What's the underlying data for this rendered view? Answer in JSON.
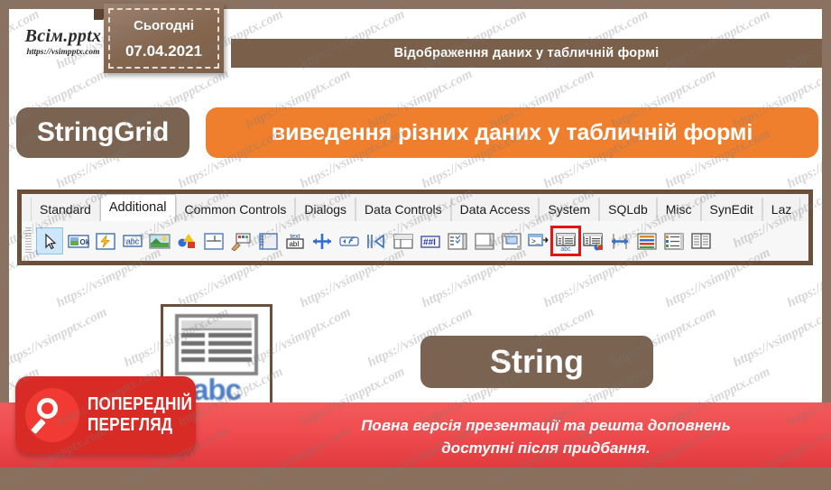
{
  "slide": {
    "logo": {
      "name": "Всім.pptx",
      "url": "https://vsimpptx.com"
    },
    "date_badge": {
      "label": "Сьогодні",
      "date": "07.04.2021"
    },
    "header_title": "Відображення даних у табличній формі",
    "tags": {
      "component": "StringGrid",
      "description": "виведення різних даних у табличній формі",
      "string": "String"
    },
    "palette": {
      "tabs": [
        {
          "label": "Standard",
          "active": false
        },
        {
          "label": "Additional",
          "active": true
        },
        {
          "label": "Common Controls",
          "active": false
        },
        {
          "label": "Dialogs",
          "active": false
        },
        {
          "label": "Data Controls",
          "active": false
        },
        {
          "label": "Data Access",
          "active": false
        },
        {
          "label": "System",
          "active": false
        },
        {
          "label": "SQLdb",
          "active": false
        },
        {
          "label": "Misc",
          "active": false
        },
        {
          "label": "SynEdit",
          "active": false
        },
        {
          "label": "Laz",
          "active": false
        }
      ],
      "icons": [
        {
          "name": "pointer-icon",
          "selected": true,
          "highlighted": false
        },
        {
          "name": "bitbtn-icon",
          "selected": false,
          "highlighted": false
        },
        {
          "name": "speedbutton-icon",
          "selected": false,
          "highlighted": false
        },
        {
          "name": "staticttext-icon",
          "selected": false,
          "highlighted": false
        },
        {
          "name": "image-icon",
          "selected": false,
          "highlighted": false
        },
        {
          "name": "shape-icon",
          "selected": false,
          "highlighted": false
        },
        {
          "name": "bevel-icon",
          "selected": false,
          "highlighted": false
        },
        {
          "name": "paintbox-icon",
          "selected": false,
          "highlighted": false
        },
        {
          "name": "notebook-icon",
          "selected": false,
          "highlighted": false
        },
        {
          "name": "labelededit-icon",
          "selected": false,
          "highlighted": false
        },
        {
          "name": "splitter-icon",
          "selected": false,
          "highlighted": false
        },
        {
          "name": "trayicon-icon",
          "selected": false,
          "highlighted": false
        },
        {
          "name": "controlbar-icon",
          "selected": false,
          "highlighted": false
        },
        {
          "name": "flowpanel-icon",
          "selected": false,
          "highlighted": false
        },
        {
          "name": "maskedit-icon",
          "selected": false,
          "highlighted": false
        },
        {
          "name": "checklistbox-icon",
          "selected": false,
          "highlighted": false
        },
        {
          "name": "scrollbox-icon",
          "selected": false,
          "highlighted": false
        },
        {
          "name": "applicationproperties-icon",
          "selected": false,
          "highlighted": false
        },
        {
          "name": "console-icon",
          "selected": false,
          "highlighted": false
        },
        {
          "name": "stringgrid-icon",
          "selected": false,
          "highlighted": true
        },
        {
          "name": "drawgrid-icon",
          "selected": false,
          "highlighted": false
        },
        {
          "name": "splitter2-icon",
          "selected": false,
          "highlighted": false
        },
        {
          "name": "colorlistbox-icon",
          "selected": false,
          "highlighted": false
        },
        {
          "name": "colorbox-icon",
          "selected": false,
          "highlighted": false
        },
        {
          "name": "valuelisteditor-icon",
          "selected": false,
          "highlighted": false
        }
      ]
    },
    "big_icon": {
      "name": "stringgrid-large-icon",
      "caption": "abc"
    },
    "preview_badge": {
      "line1": "ПОПЕРЕДНІЙ",
      "line2": "ПЕРЕГЛЯД",
      "icon": "magnifier-icon"
    },
    "bottom_notice": {
      "line1": "Повна версія презентації та решта доповнень",
      "line2": "доступні після придбання."
    },
    "watermark_text": "https://vsimpptx.com",
    "colors": {
      "frame_brown": "#8b7160",
      "header_brown": "#7a5f4b",
      "tag_brown": "#7a6350",
      "accent_orange": "#f07f2d",
      "banner_red": "#ef4b4e",
      "badge_red": "#d92b26",
      "highlight_red": "#e8130e",
      "palette_border": "#6b4f39"
    }
  }
}
